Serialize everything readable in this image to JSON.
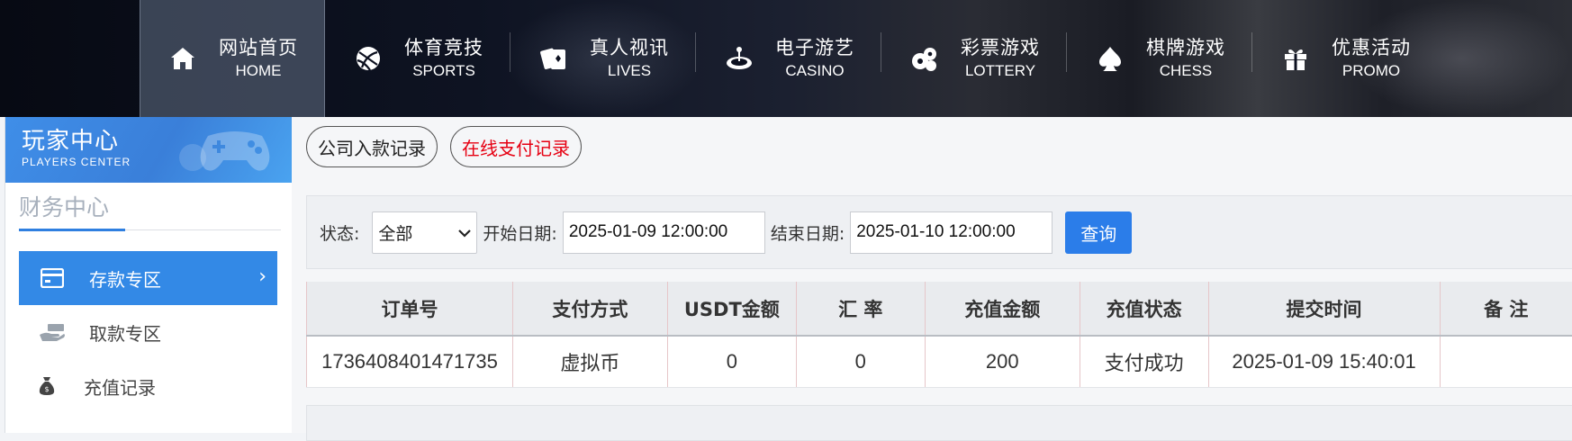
{
  "nav": {
    "items": [
      {
        "cn": "网站首页",
        "en": "HOME",
        "icon": "home-icon"
      },
      {
        "cn": "体育竞技",
        "en": "SPORTS",
        "icon": "ball-icon"
      },
      {
        "cn": "真人视讯",
        "en": "LIVES",
        "icon": "cards-icon"
      },
      {
        "cn": "电子游艺",
        "en": "CASINO",
        "icon": "casino-icon"
      },
      {
        "cn": "彩票游戏",
        "en": "LOTTERY",
        "icon": "lottery-icon"
      },
      {
        "cn": "棋牌游戏",
        "en": "CHESS",
        "icon": "spade-icon"
      },
      {
        "cn": "优惠活动",
        "en": "PROMO",
        "icon": "gift-icon"
      }
    ]
  },
  "sidebar": {
    "title_cn": "玩家中心",
    "title_en": "PLAYERS CENTER",
    "section": "财务中心",
    "items": [
      {
        "label": "存款专区",
        "icon": "card-icon"
      },
      {
        "label": "取款专区",
        "icon": "hand-money-icon"
      },
      {
        "label": "充值记录",
        "icon": "money-bag-icon"
      }
    ],
    "accent": "#3389e6"
  },
  "tabs": [
    {
      "label": "公司入款记录"
    },
    {
      "label": "在线支付记录"
    }
  ],
  "filter": {
    "status_label": "状态:",
    "status_value": "全部",
    "start_label": "开始日期:",
    "start_value": "2025-01-09 12:00:00",
    "end_label": "结束日期:",
    "end_value": "2025-01-10 12:00:00",
    "query_label": "查询"
  },
  "table": {
    "headers": [
      "订单号",
      "支付方式",
      "USDT金额",
      "汇 率",
      "充值金额",
      "充值状态",
      "提交时间",
      "备 注"
    ],
    "rows": [
      [
        "1736408401471735",
        "虚拟币",
        "0",
        "0",
        "200",
        "支付成功",
        "2025-01-09 15:40:01",
        ""
      ]
    ]
  },
  "colors": {
    "primary": "#2b7de9",
    "active_tab_text": "#e60012"
  }
}
